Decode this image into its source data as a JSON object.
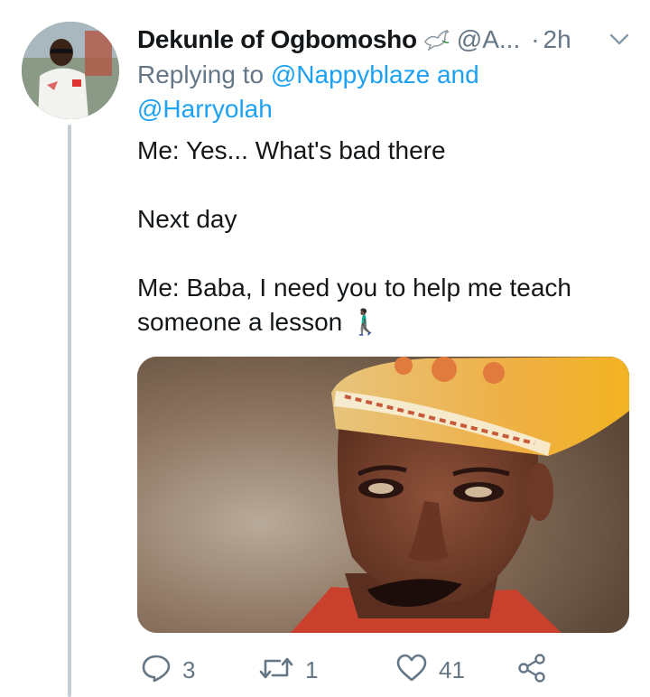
{
  "tweet": {
    "display_name": "Dekunle of Ogbomosho",
    "badge_icon": "dove-icon",
    "handle": "@A...",
    "separator": "·",
    "timestamp": "2h",
    "replying_prefix": "Replying to",
    "replying_mentions": [
      "@Nappyblaze",
      "@Harryolah"
    ],
    "replying_joiner": "and",
    "lines": [
      "Me: Yes... What's bad there",
      "",
      "Next day",
      "",
      "Me: Baba, I need you to help me teach someone a lesson 🚶🏿‍♂️"
    ],
    "image_alt": "photo of an older man in a gold and orange embroidered cap with dark lipstick and eyeliner"
  },
  "actions": {
    "reply_count": "3",
    "retweet_count": "1",
    "like_count": "41"
  },
  "colors": {
    "text": "#14171a",
    "muted": "#657786",
    "link": "#1da1f2",
    "thread_line": "#c4ccd4"
  }
}
